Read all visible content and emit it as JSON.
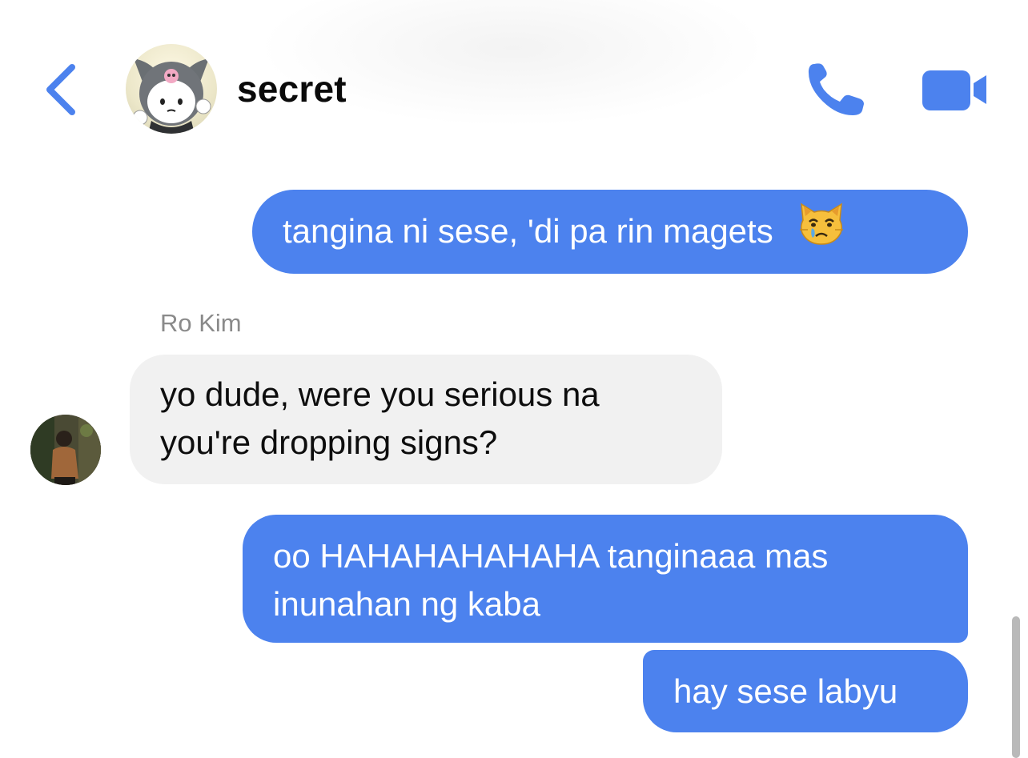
{
  "header": {
    "title": "secret",
    "back_icon": "chevron-left-icon",
    "call_icon": "phone-icon",
    "video_icon": "video-camera-icon",
    "accent_color": "#4c82ee"
  },
  "messages": [
    {
      "direction": "outgoing",
      "lines": [
        "tangina ni sese, 'di pa rin magets"
      ],
      "emoji": "crying-cat-face"
    },
    {
      "direction": "incoming",
      "sender": "Ro Kim",
      "lines": [
        "yo dude, were you serious na",
        "you're dropping signs?"
      ]
    },
    {
      "direction": "outgoing",
      "lines": [
        "oo HAHAHAHAHAHA tanginaaa mas",
        "inunahan ng kaba"
      ]
    },
    {
      "direction": "outgoing",
      "lines": [
        "hay sese labyu"
      ]
    }
  ],
  "colors": {
    "outgoing_bubble": "#4c82ee",
    "incoming_bubble": "#f1f1f1",
    "sender_label": "#8a8a8a"
  }
}
